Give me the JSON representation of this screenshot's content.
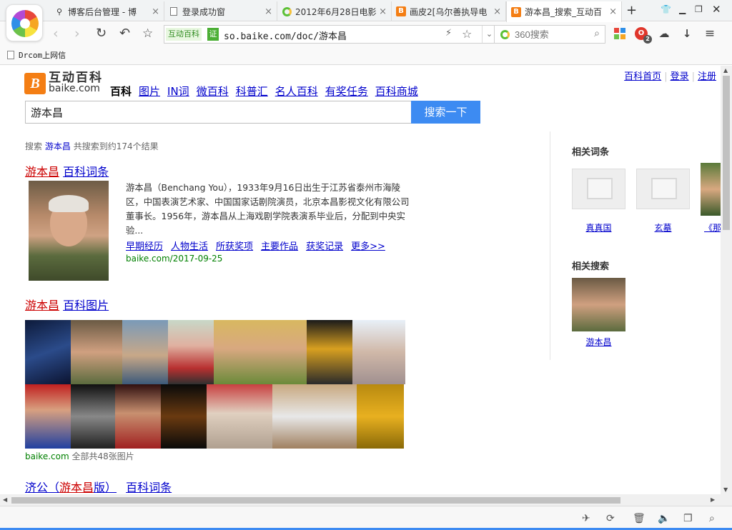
{
  "browser": {
    "tabs": [
      {
        "label": "博客后台管理 - 博",
        "icon": "wand-icon"
      },
      {
        "label": "登录成功窗",
        "icon": "document-icon"
      },
      {
        "label": "2012年6月28日电影",
        "icon": "360-icon"
      },
      {
        "label": "画皮2[乌尔善执导电",
        "icon": "hudong-icon"
      },
      {
        "label": "游本昌_搜索_互动百",
        "icon": "hudong-icon",
        "active": true
      }
    ],
    "new_tab": "+",
    "url_badge": "互动百科",
    "url_cert": "证",
    "url": "so.baike.com/doc/游本昌",
    "search_placeholder": "360搜索",
    "bookmark": "Drcom上网信",
    "opera_badge": "2"
  },
  "page": {
    "toplinks": [
      "百科首页",
      "登录",
      "注册"
    ],
    "logo_cn": "互动百科",
    "logo_en": "baike.com",
    "nav_current": "百科",
    "nav_links": [
      "图片",
      "IN词",
      "微百科",
      "科普汇",
      "名人百科",
      "有奖任务",
      "百科商城"
    ],
    "search_value": "游本昌",
    "search_button": "搜索一下",
    "result_info_prefix": "搜索",
    "result_info_keyword": "游本昌",
    "result_info_suffix": "共搜索到约174个结果",
    "results": [
      {
        "title_hl": "游本昌",
        "title_link": "百科词条",
        "desc": "游本昌（Benchang You），1933年9月16日出生于江苏省泰州市海陵区，中国表演艺术家、中国国家话剧院演员，北京本昌影视文化有限公司董事长。1956年，游本昌从上海戏剧学院表演系毕业后，分配到中央实验...",
        "links": [
          "早期经历",
          "人物生活",
          "所获奖项",
          "主要作品",
          "获奖记录",
          "更多>>"
        ],
        "source": "baike.com/2017-09-25"
      },
      {
        "title_hl": "游本昌",
        "title_link": "百科图片",
        "source": "baike.com",
        "source_suffix": "全部共48张图片"
      },
      {
        "title_link_a": "济公（",
        "title_hl": "游本昌",
        "title_link_b": "版）",
        "title_link": "百科词条"
      }
    ],
    "related_terms_title": "相关词条",
    "related_terms": [
      "真真国",
      "玄墓",
      "《那"
    ],
    "related_search_title": "相关搜索",
    "related_search": [
      "游本昌"
    ]
  },
  "colors": {
    "link": "#0000cc",
    "highlight": "#cc0000",
    "button": "#3d8bf2",
    "source_green": "#008000",
    "brand_orange": "#f47e14"
  }
}
